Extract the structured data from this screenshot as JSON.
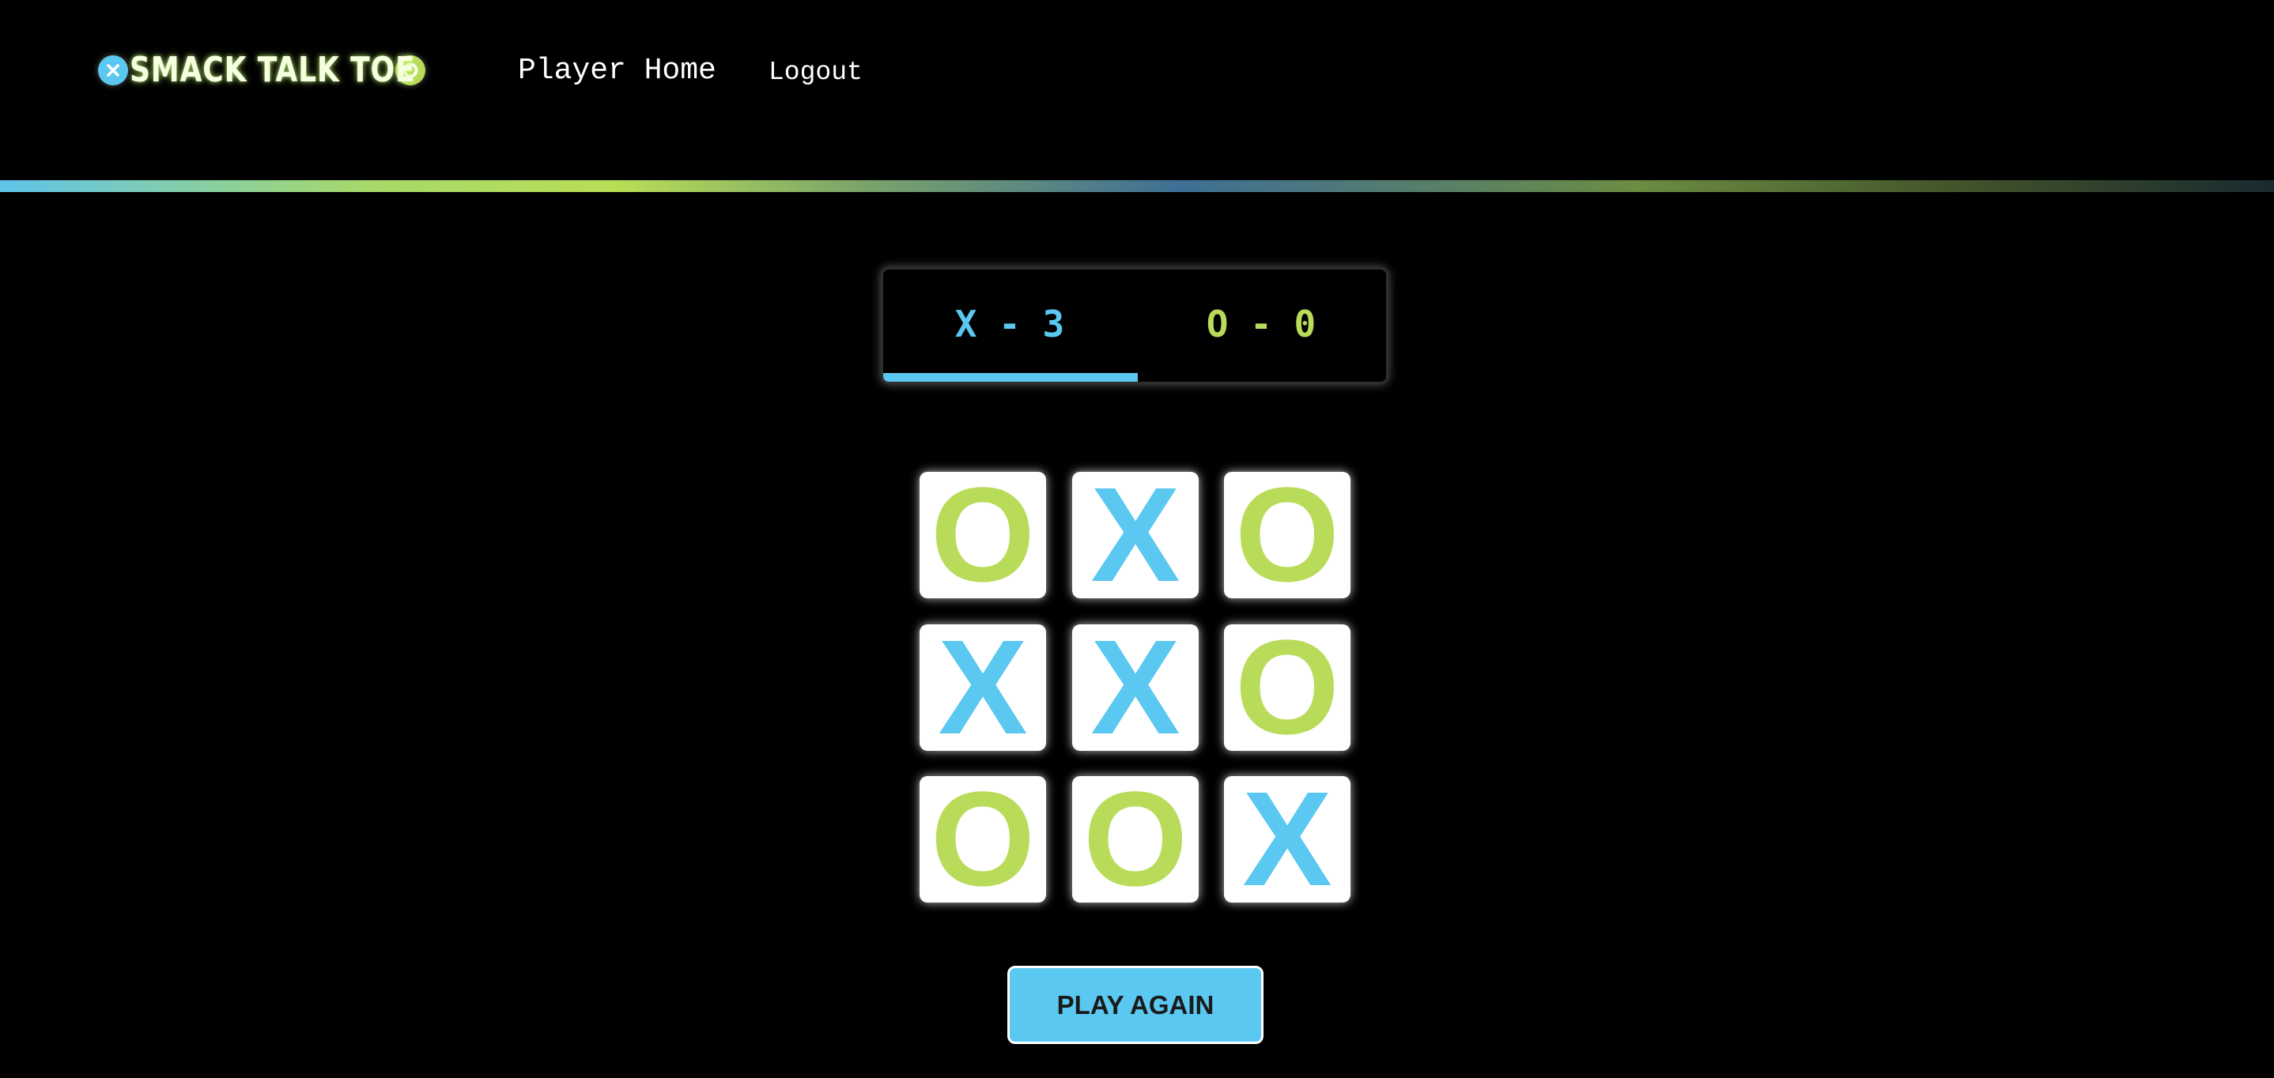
{
  "header": {
    "logo": {
      "text": "SMACK TALK  TOE",
      "left_icon": "x-circle-icon",
      "right_icon": "o-circle-icon"
    },
    "nav": {
      "home_label": "Player Home",
      "logout_label": "Logout"
    }
  },
  "scoreboard": {
    "x_score": "X - 3",
    "o_score": "O - 0",
    "active_player": "X"
  },
  "board": {
    "cells": [
      "O",
      "X",
      "O",
      "X",
      "X",
      "O",
      "O",
      "O",
      "X"
    ]
  },
  "actions": {
    "play_again_label": "PLAY AGAIN"
  },
  "colors": {
    "background": "#000000",
    "x_color": "#5ac8f0",
    "o_color": "#b8dc5a",
    "cell_background": "#ffffff",
    "button_background": "#5ac8f0"
  }
}
